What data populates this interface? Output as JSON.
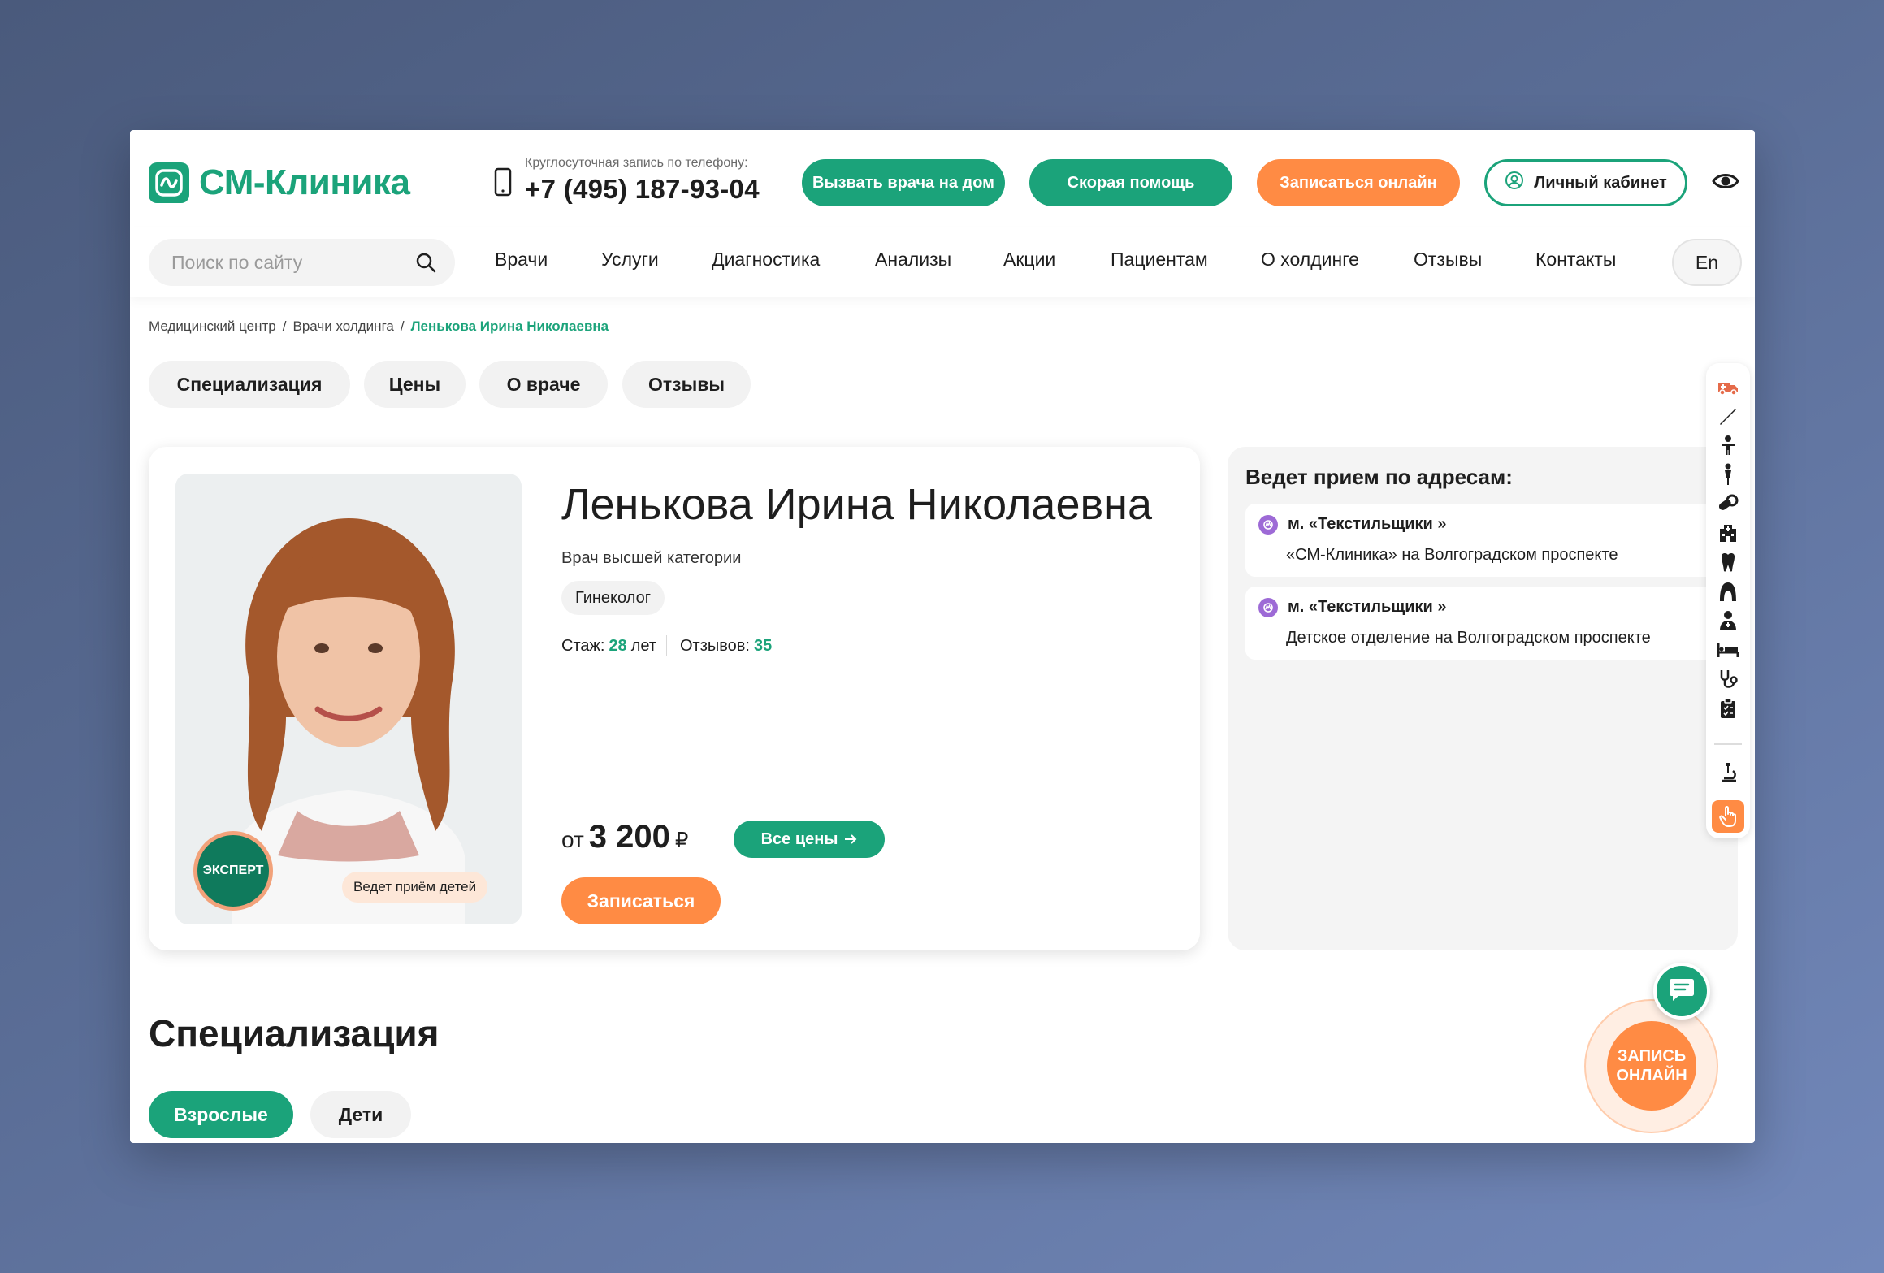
{
  "brand": {
    "name": "СМ-Клиника",
    "color": "#1ba37a",
    "accent": "#ff8b44"
  },
  "header": {
    "phone_caption": "Круглосуточная запись по телефону:",
    "phone_number": "+7 (495) 187-93-04",
    "call_doctor": "Вызвать врача на дом",
    "ambulance": "Скорая помощь",
    "book_online": "Записаться онлайн",
    "account": "Личный кабинет"
  },
  "search": {
    "placeholder": "Поиск по сайту"
  },
  "nav": {
    "items": [
      "Врачи",
      "Услуги",
      "Диагностика",
      "Анализы",
      "Акции",
      "Пациентам",
      "О холдинге",
      "Отзывы",
      "Контакты"
    ],
    "lang": "En"
  },
  "breadcrumb": [
    "Медицинский центр",
    "Врачи холдинга",
    "Ленькова Ирина Николаевна"
  ],
  "page_tabs": [
    "Специализация",
    "Цены",
    "О враче",
    "Отзывы"
  ],
  "doctor": {
    "name": "Ленькова Ирина Николаевна",
    "category": "Врач высшей категории",
    "specialty": "Гинеколог",
    "experience_label": "Стаж:",
    "experience_value": "28",
    "experience_unit": "лет",
    "reviews_label": "Отзывов:",
    "reviews_value": "35",
    "badge_expert": "ЭКСПЕРТ",
    "badge_kids": "Ведет приём детей",
    "price_from": "от",
    "price_value": "3 200",
    "price_currency": "₽",
    "all_prices": "Все цены",
    "book": "Записаться"
  },
  "addresses": {
    "title": "Ведет прием по адресам:",
    "items": [
      {
        "metro": "м. «Текстильщики »",
        "clinic": "«СМ-Клиника» на Волгоградском проспекте"
      },
      {
        "metro": "м. «Текстильщики »",
        "clinic": "Детское отделение на Волгоградском проспекте"
      }
    ]
  },
  "specialization": {
    "title": "Специализация",
    "tabs": [
      "Взрослые",
      "Дети"
    ]
  },
  "floating": {
    "online_booking": "ЗАПИСЬ ОНЛАЙН"
  },
  "sidebar_icons": [
    "ambulance-icon",
    "scalpel-icon",
    "child-icon",
    "woman-icon",
    "pills-icon",
    "hospital-icon",
    "tooth-icon",
    "hair-icon",
    "doctor-icon",
    "bed-icon",
    "stethoscope-icon",
    "clipboard-icon",
    "microscope-icon",
    "hand-pointer-icon"
  ]
}
